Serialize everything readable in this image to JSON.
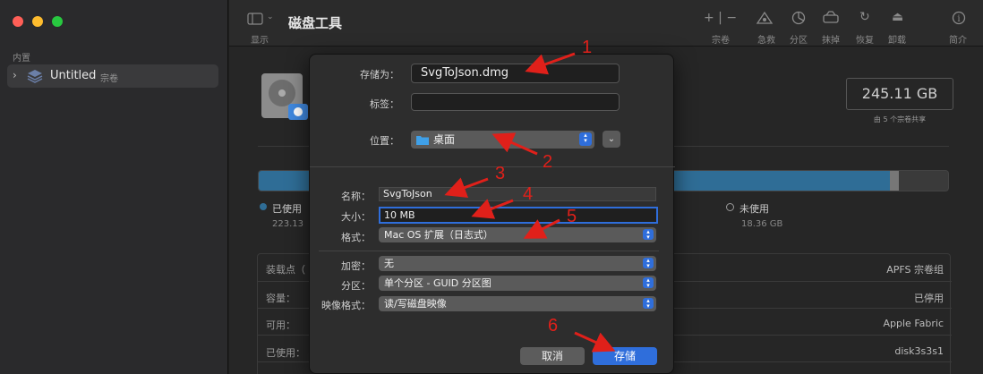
{
  "sidebar": {
    "section": "内置",
    "item_name": "Untitled",
    "item_sub": "宗卷"
  },
  "toolbar": {
    "title": "磁盘工具",
    "display_label": "显示",
    "volume_label": "宗卷",
    "firstaid_label": "急救",
    "partition_label": "分区",
    "erase_label": "抹掉",
    "restore_label": "恢复",
    "unmount_label": "卸载",
    "info_label": "简介"
  },
  "volume": {
    "capacity": "245.11 GB",
    "shared": "由 5 个宗卷共享",
    "used_label": "已使用",
    "used_value": "223.13",
    "free_label": "未使用",
    "free_value": "18.36 GB",
    "used_fraction": 0.916
  },
  "info": {
    "mount_label": "装载点（",
    "capacity_label": "容量：",
    "available_label": "可用：",
    "used_label": "已使用：",
    "type_value": "APFS 宗卷组",
    "status_value": "已停用",
    "connection_value": "Apple Fabric",
    "device_value": "disk3s3s1"
  },
  "dialog": {
    "saveas_label": "存储为：",
    "saveas_value": "SvgToJson.dmg",
    "tags_label": "标签：",
    "location_label": "位置：",
    "location_value": "桌面",
    "name_label": "名称：",
    "name_value": "SvgToJson",
    "size_label": "大小：",
    "size_value": "10 MB",
    "format_label": "格式：",
    "format_value": "Mac OS 扩展（日志式）",
    "encrypt_label": "加密：",
    "encrypt_value": "无",
    "partition_label": "分区：",
    "partition_value": "单个分区 - GUID 分区图",
    "imageformat_label": "映像格式：",
    "imageformat_value": "读/写磁盘映像",
    "cancel_label": "取消",
    "save_label": "存储"
  },
  "annotations": {
    "n1": "1",
    "n2": "2",
    "n3": "3",
    "n4": "4",
    "n5": "5",
    "n6": "6"
  },
  "colors": {
    "accent": "#2f6edb",
    "annotation": "#e0201a"
  }
}
